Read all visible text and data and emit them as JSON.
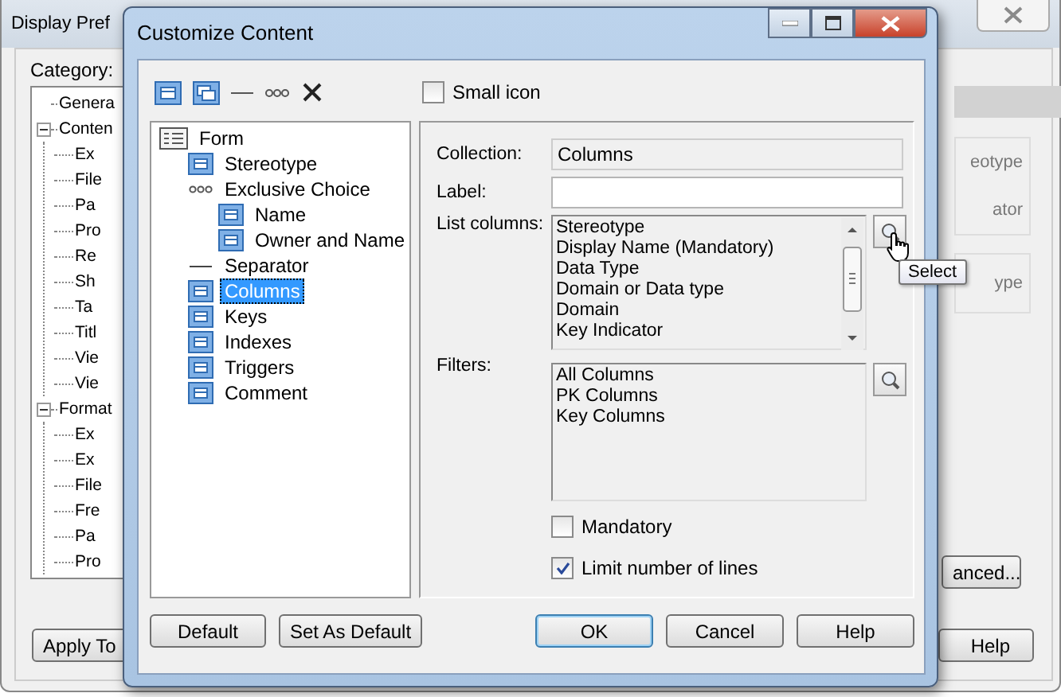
{
  "background_window": {
    "title": "Display Pref",
    "category_label": "Category:",
    "tree": [
      {
        "label": "Genera"
      },
      {
        "label": "Conten",
        "expanded": true,
        "children": [
          {
            "label": "Ex"
          },
          {
            "label": "File"
          },
          {
            "label": "Pa"
          },
          {
            "label": "Pro"
          },
          {
            "label": "Re"
          },
          {
            "label": "Sh"
          },
          {
            "label": "Ta"
          },
          {
            "label": "Titl"
          },
          {
            "label": "Vie"
          },
          {
            "label": "Vie"
          }
        ]
      },
      {
        "label": "Format",
        "expanded": true,
        "children": [
          {
            "label": "Ex"
          },
          {
            "label": "Ex"
          },
          {
            "label": "File"
          },
          {
            "label": "Fre"
          },
          {
            "label": "Pa"
          },
          {
            "label": "Pro"
          }
        ]
      }
    ],
    "fragments": [
      "eotype",
      "ator",
      "ype"
    ],
    "advanced_button": "anced...",
    "apply_button": "Apply To",
    "help_button": "Help"
  },
  "dialog": {
    "title": "Customize Content",
    "small_icon": {
      "label": "Small icon",
      "checked": false
    },
    "tree": [
      {
        "label": "Form",
        "kind": "form",
        "selected": false,
        "children": [
          {
            "label": "Stereotype",
            "kind": "attribute",
            "selected": false
          },
          {
            "label": "Exclusive Choice",
            "kind": "choice",
            "selected": false,
            "children": [
              {
                "label": "Name",
                "kind": "attribute",
                "selected": false
              },
              {
                "label": "Owner and Name",
                "kind": "attribute",
                "selected": false
              }
            ]
          },
          {
            "label": "Separator",
            "kind": "separator",
            "selected": false
          },
          {
            "label": "Columns",
            "kind": "attribute",
            "selected": true
          },
          {
            "label": "Keys",
            "kind": "attribute",
            "selected": false
          },
          {
            "label": "Indexes",
            "kind": "attribute",
            "selected": false
          },
          {
            "label": "Triggers",
            "kind": "attribute",
            "selected": false
          },
          {
            "label": "Comment",
            "kind": "attribute",
            "selected": false
          }
        ]
      }
    ],
    "collection": {
      "label": "Collection:",
      "value": "Columns"
    },
    "label_field": {
      "label": "Label:"
    },
    "list_columns": {
      "label": "List columns:",
      "items": [
        "Stereotype",
        "Display Name (Mandatory)",
        "Data Type",
        "Domain or Data type",
        "Domain",
        "Key Indicator"
      ],
      "tooltip": "Select"
    },
    "filters": {
      "label": "Filters:",
      "items": [
        "All Columns",
        "PK Columns",
        "Key Columns"
      ]
    },
    "mandatory": {
      "label": "Mandatory",
      "checked": false
    },
    "limit_lines": {
      "label": "Limit number of lines",
      "checked": true
    },
    "left_buttons": [
      "Default",
      "Set As Default"
    ],
    "buttons": [
      {
        "label": "OK",
        "default": true
      },
      {
        "label": "Cancel",
        "default": false
      },
      {
        "label": "Help",
        "default": false
      }
    ]
  }
}
